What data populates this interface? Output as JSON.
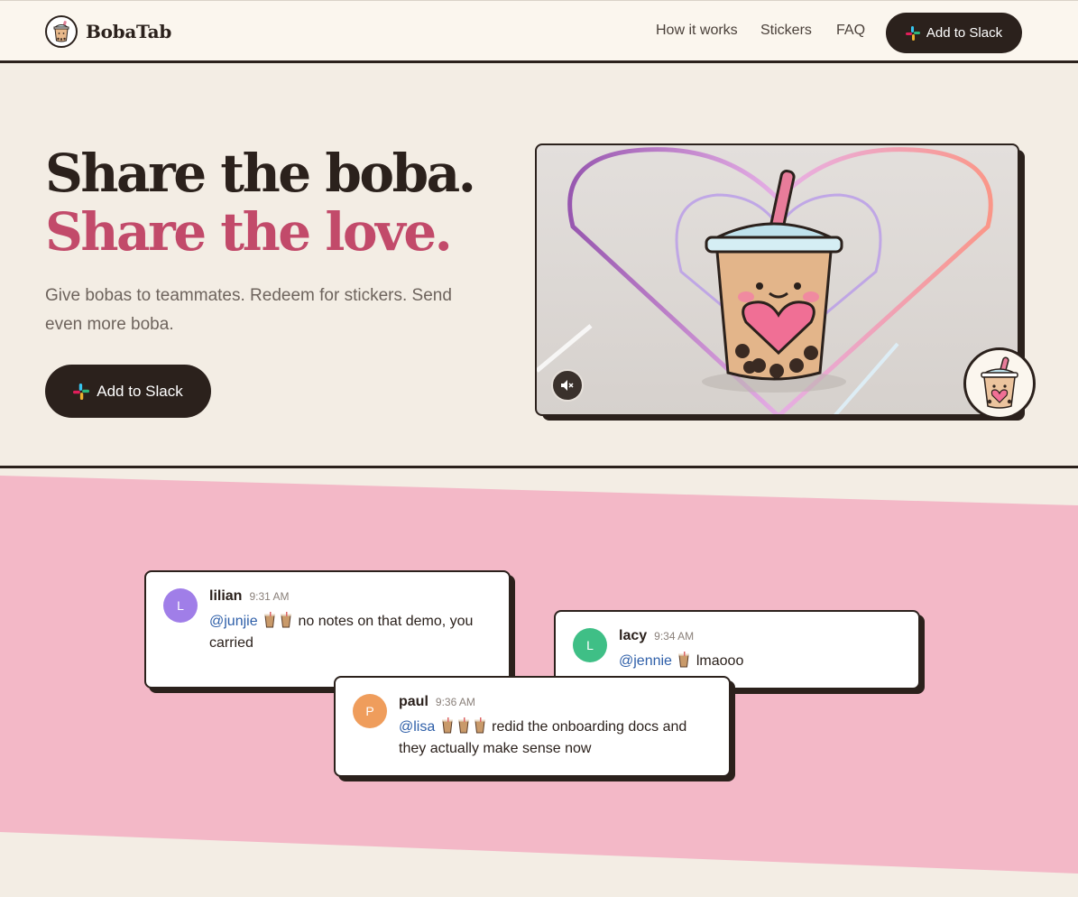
{
  "brand": {
    "name": "BobaTab"
  },
  "nav": {
    "links": [
      "How it works",
      "Stickers",
      "FAQ"
    ],
    "cta_label": "Add to Slack"
  },
  "hero": {
    "headline_line1": "Share the boba.",
    "headline_line2": "Share the love.",
    "subtitle": "Give bobas to teammates. Redeem for stickers. Send even more boba.",
    "cta_label": "Add to Slack"
  },
  "messages": [
    {
      "name": "lilian",
      "initial": "L",
      "time": "9:31 AM",
      "mention": "@junjie",
      "bobas": 2,
      "text": "no notes on that demo, you carried",
      "avatar_color": "#a07ee8"
    },
    {
      "name": "lacy",
      "initial": "L",
      "time": "9:34 AM",
      "mention": "@jennie",
      "bobas": 1,
      "text": "lmaooo",
      "avatar_color": "#3fbf86"
    },
    {
      "name": "paul",
      "initial": "P",
      "time": "9:36 AM",
      "mention": "@lisa",
      "bobas": 3,
      "text": "redid the onboarding docs and they actually make sense now",
      "avatar_color": "#ef9d5c"
    }
  ],
  "colors": {
    "ink": "#2b211c",
    "accent": "#c24a6a",
    "pink_band": "#f3b8c7",
    "cream": "#f3ede4"
  },
  "icons": [
    "boba-logo-icon",
    "slack-icon",
    "mute-icon",
    "boba-cup-icon"
  ]
}
